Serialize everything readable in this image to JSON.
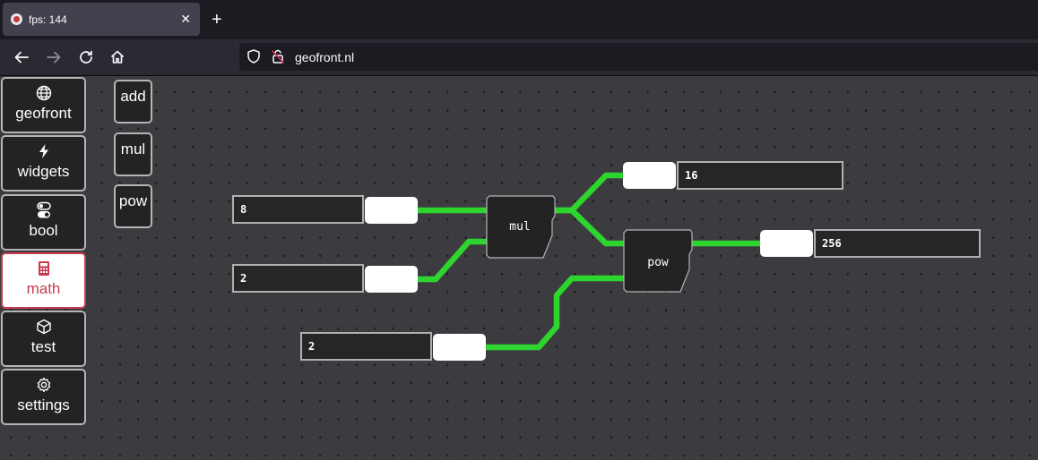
{
  "browser": {
    "tab": {
      "title": "fps: 144",
      "close": "✕"
    },
    "new_tab": "+",
    "url": "geofront.nl"
  },
  "sidebar": {
    "items": [
      {
        "label": "geofront",
        "icon": "globe-icon"
      },
      {
        "label": "widgets",
        "icon": "lightning-icon"
      },
      {
        "label": "bool",
        "icon": "toggle-icon"
      },
      {
        "label": "math",
        "icon": "calculator-icon",
        "active": true
      },
      {
        "label": "test",
        "icon": "cube-icon"
      },
      {
        "label": "settings",
        "icon": "gear-icon"
      }
    ]
  },
  "palette": {
    "items": [
      "add",
      "mul",
      "pow"
    ]
  },
  "graph": {
    "inputs": [
      "8",
      "2",
      "2"
    ],
    "nodes": {
      "mul": "mul",
      "pow": "pow"
    },
    "outputs": [
      "16",
      "256"
    ]
  },
  "colors": {
    "wire": "#2ed52e",
    "active_accent": "#c63c4c",
    "canvas": "#3c3c40",
    "panel": "#232323"
  }
}
